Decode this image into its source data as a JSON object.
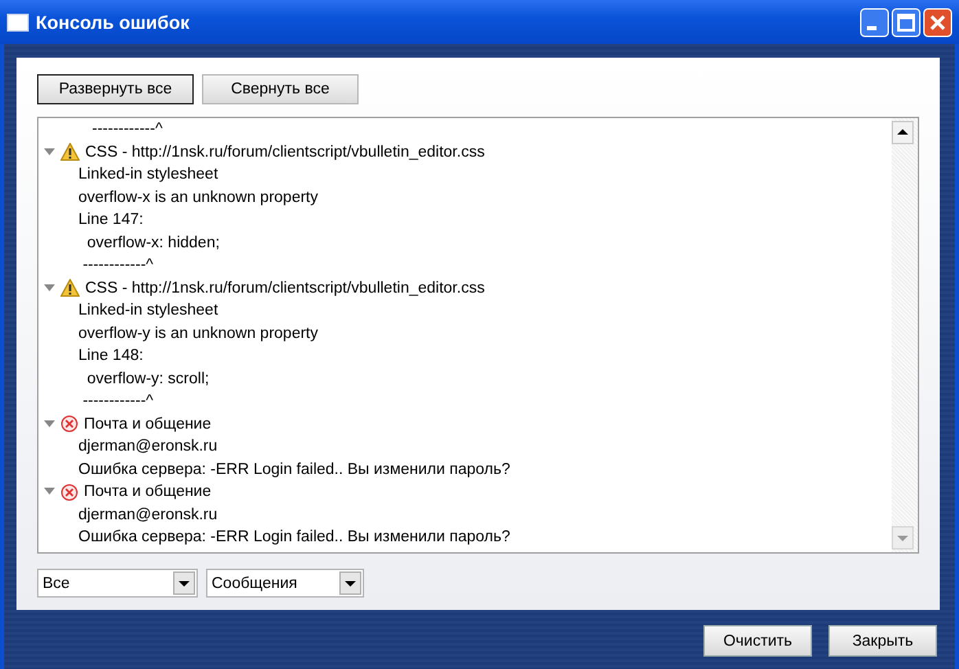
{
  "window": {
    "title": "Консоль ошибок"
  },
  "toolbar": [
    {
      "label": "Развернуть все",
      "selected": true
    },
    {
      "label": "Свернуть все",
      "selected": false
    }
  ],
  "partial_line": "------------^",
  "entries": [
    {
      "kind": "warning",
      "expanded": true,
      "header": "CSS - http://1nsk.ru/forum/clientscript/vbulletin_editor.css",
      "lines": [
        "Linked-in stylesheet",
        "overflow-x is an unknown property",
        "Line 147:",
        "  overflow-x: hidden;",
        " ------------^"
      ]
    },
    {
      "kind": "warning",
      "expanded": true,
      "header": "CSS - http://1nsk.ru/forum/clientscript/vbulletin_editor.css",
      "lines": [
        "Linked-in stylesheet",
        "overflow-y is an unknown property",
        "Line 148:",
        "  overflow-y: scroll;",
        " ------------^"
      ]
    },
    {
      "kind": "error",
      "expanded": true,
      "header": "Почта и общение",
      "lines": [
        "djerman@eronsk.ru",
        "Ошибка сервера: -ERR Login failed.. Вы изменили пароль?"
      ]
    },
    {
      "kind": "error",
      "expanded": true,
      "header": "Почта и общение",
      "lines": [
        "djerman@eronsk.ru",
        "Ошибка сервера: -ERR Login failed.. Вы изменили пароль?"
      ]
    }
  ],
  "filters": [
    {
      "value": "Все"
    },
    {
      "value": "Сообщения"
    }
  ],
  "buttons": [
    "Очистить",
    "Закрыть"
  ]
}
